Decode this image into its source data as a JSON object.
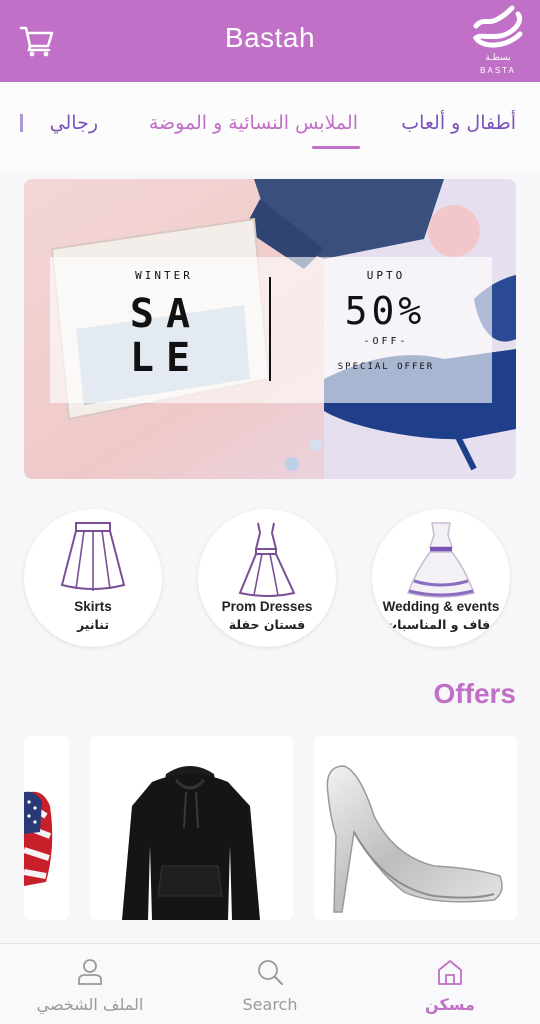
{
  "header": {
    "title": "Bastah",
    "logo_arabic": "بسطـة",
    "logo_latin": "BASTA",
    "cart_icon": "cart-icon",
    "brand_color": "#c070c6"
  },
  "tabs": {
    "items": [
      {
        "label": "أطفال و ألعاب"
      },
      {
        "label": "الملابس النسائية و الموضة",
        "selected": true
      },
      {
        "label": "رجالي"
      }
    ],
    "active_color": "#c070c6",
    "inactive_color": "#7a53b8"
  },
  "banner": {
    "winter": "WINTER",
    "sale_line1": "SA",
    "sale_line2": "LE",
    "upto": "UPTO",
    "percent": "50%",
    "off": "-OFF-",
    "special_offer": "SPECIAL OFFER"
  },
  "subcategories": [
    {
      "label_en": "Skirts",
      "label_ar": "تنانير",
      "icon": "skirt-icon"
    },
    {
      "label_en": "Prom Dresses",
      "label_ar": "فستان حفلة",
      "icon": "dress-icon"
    },
    {
      "label_en": "Wedding & events",
      "label_ar": "زفاف و المناسبات",
      "icon": "wedding-dress-icon"
    }
  ],
  "offers": {
    "title": "Offers",
    "items": [
      {
        "icon": "flag-shirt-image"
      },
      {
        "icon": "hoodie-image"
      },
      {
        "icon": "high-heel-shoe-image"
      }
    ]
  },
  "bottom_nav": {
    "items": [
      {
        "label": "الملف الشخصي",
        "icon": "user-icon"
      },
      {
        "label": "Search",
        "icon": "search-icon"
      },
      {
        "label": "مسكن",
        "icon": "home-icon",
        "active": true
      }
    ]
  }
}
